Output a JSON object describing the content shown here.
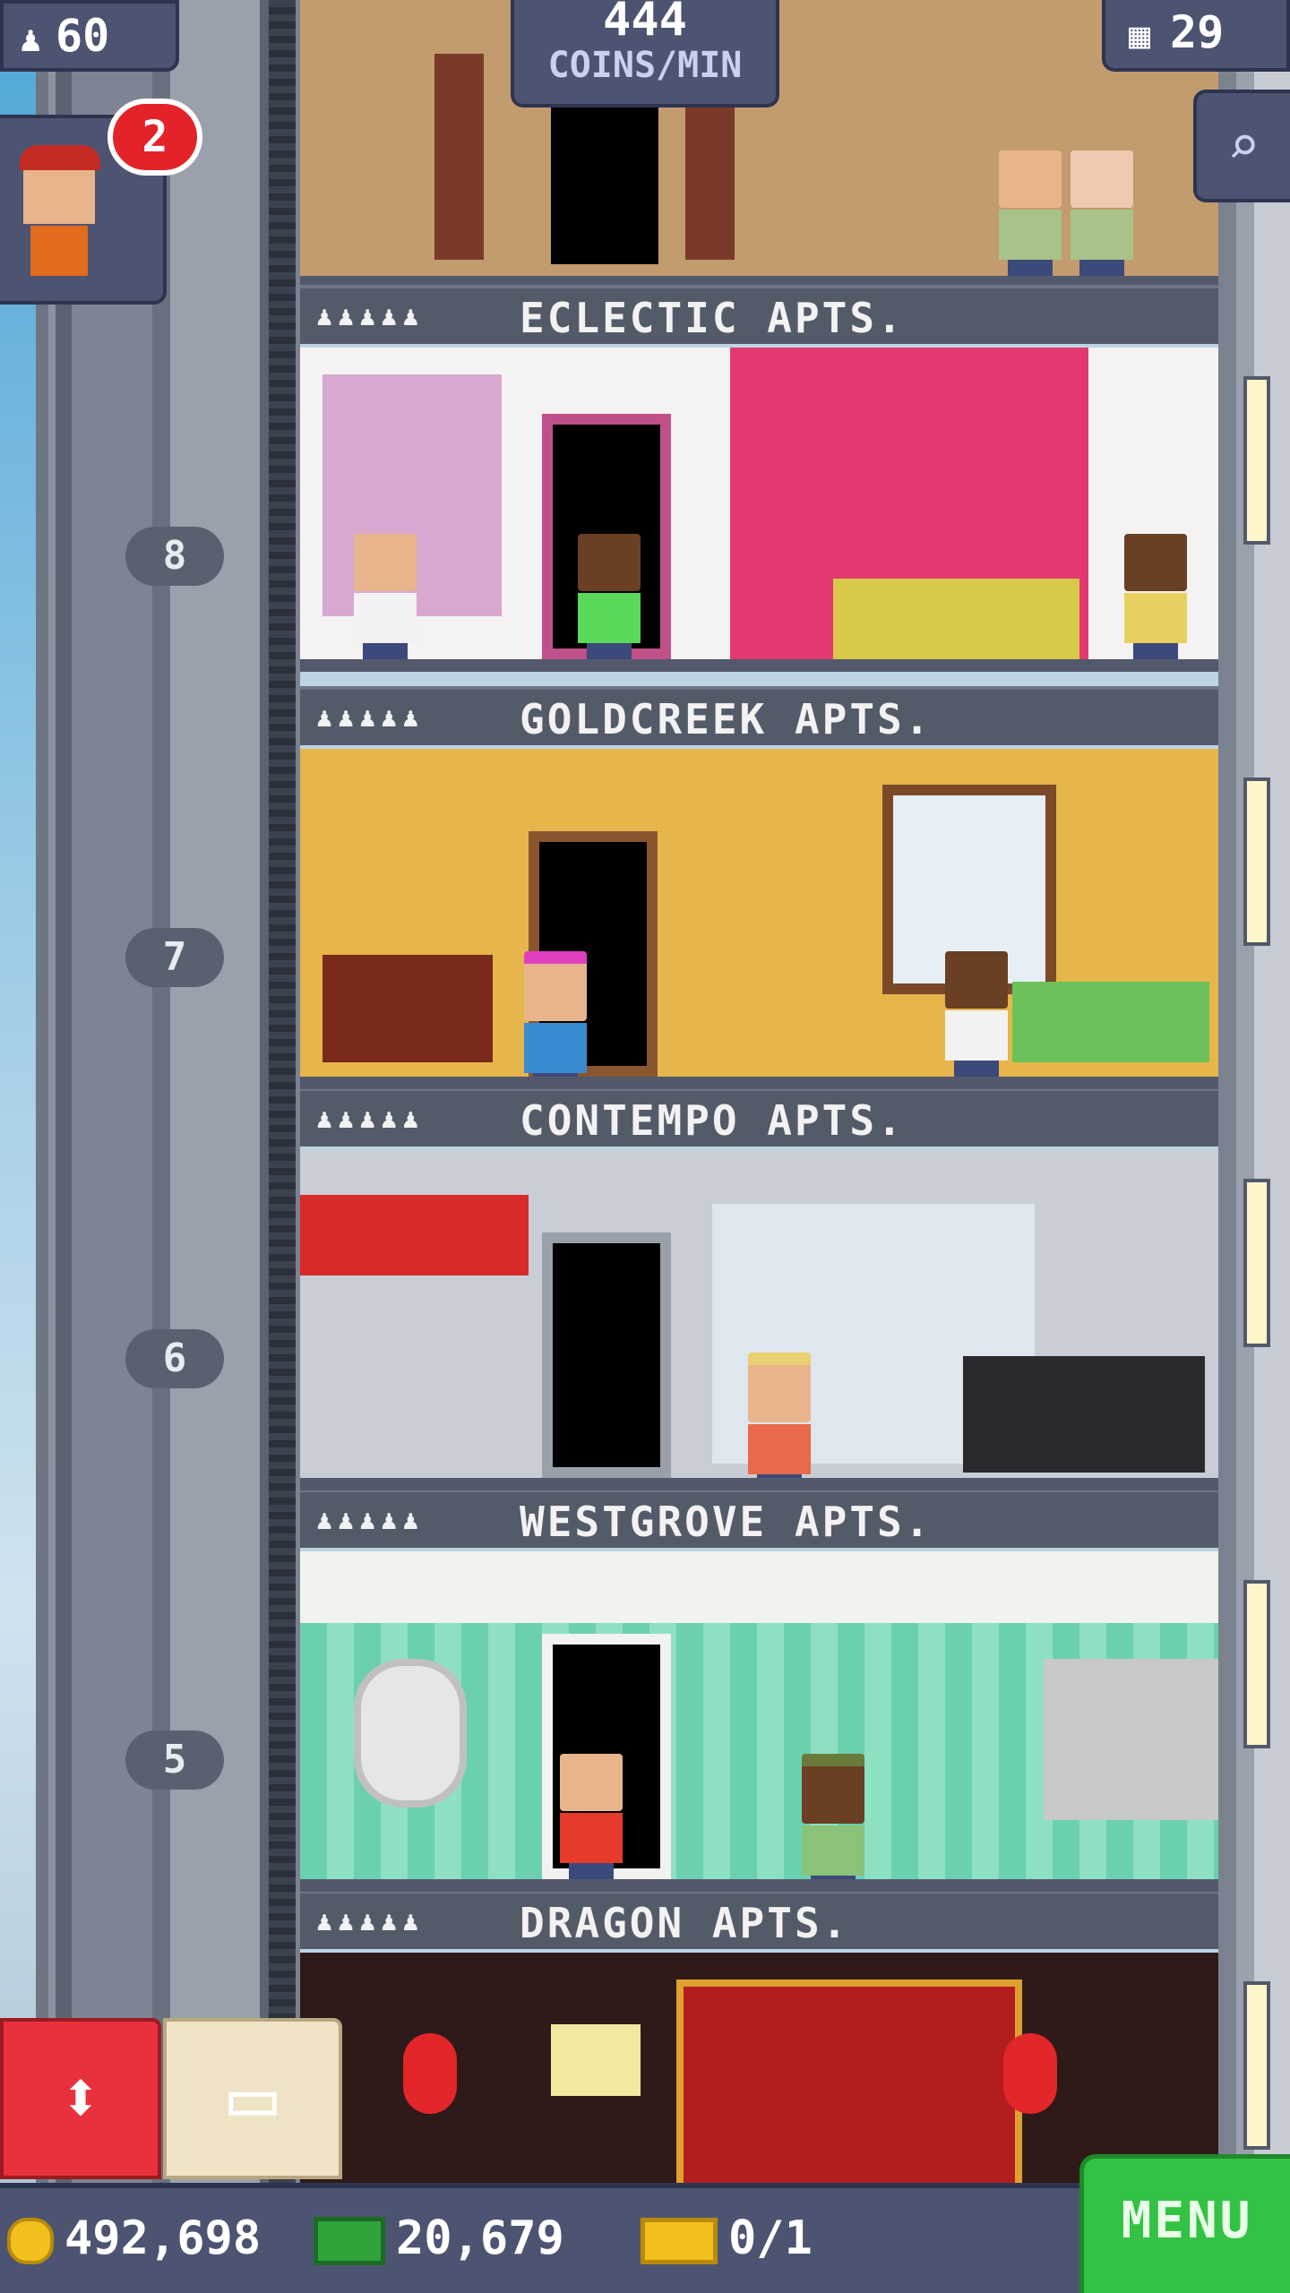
{
  "hud": {
    "population": "60",
    "coins_per_min_value": "444",
    "coins_per_min_unit": "COINS/MIN",
    "floors": "29",
    "visitor_badge": "2"
  },
  "apartments": [
    {
      "name": "ECLECTIC APTS."
    },
    {
      "name": "GOLDCREEK APTS."
    },
    {
      "name": "CONTEMPO APTS."
    },
    {
      "name": "WESTGROVE APTS."
    },
    {
      "name": "DRAGON APTS."
    }
  ],
  "residents_icons": "♟♟♟♟♟",
  "elevator_floors": [
    "8",
    "7",
    "6",
    "5"
  ],
  "bottom": {
    "coins": "492,698",
    "bux": "20,679",
    "tickets": "0/1",
    "menu_label": "MENU"
  },
  "colors": {
    "hud_bg": "#4d5472",
    "menu_green": "#33c243",
    "elevator_red": "#e8313c"
  },
  "icons": {
    "population": "person-icon",
    "floors": "building-icon",
    "zoom": "zoom-out-icon",
    "elevator": "up-down-arrows-icon",
    "box": "storage-box-icon",
    "coins": "coin-icon",
    "bux": "tower-bux-icon",
    "tickets": "golden-ticket-icon"
  }
}
